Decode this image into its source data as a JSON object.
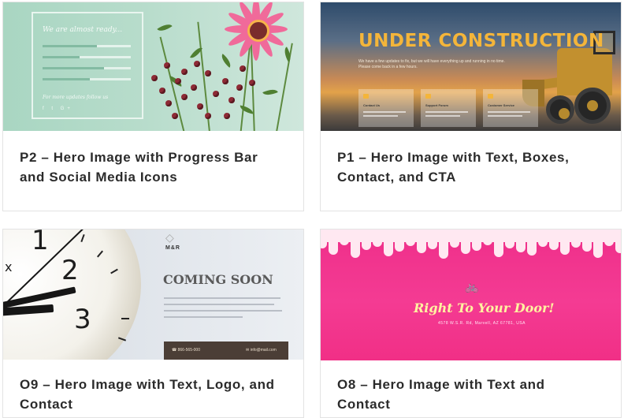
{
  "cards": [
    {
      "title": "P2 – Hero Image with Progress Bar and Social Media Icons",
      "title_line1": "P2 – Hero Image with Progress Bar",
      "title_line2": "and Social Media Icons",
      "preview": {
        "heading": "We are almost ready...",
        "progress": [
          0.62,
          0.42,
          0.7,
          0.54
        ],
        "footer": "For more updates follow us",
        "social_icons": [
          "facebook-icon",
          "twitter-icon",
          "google-plus-icon"
        ],
        "social_glyphs": "f t G+"
      }
    },
    {
      "title": "P1 – Hero Image with Text, Boxes, Contact, and CTA",
      "title_line1": "P1 – Hero Image with Text, Boxes,",
      "title_line2": "Contact, and CTA",
      "preview": {
        "heading": "UNDER CONSTRUCTION",
        "intro": "We have a few updates to fix, but we will have everything up and running in no time. Please come back in a few hours.",
        "boxes": [
          "Contact Us",
          "Support Forum",
          "Customer Service"
        ]
      }
    },
    {
      "title": "O9 – Hero Image with Text, Logo, and Contact",
      "title_line1": "O9 – Hero Image with Text, Logo, and",
      "title_line2": "Contact",
      "preview": {
        "logo": "M&R",
        "heading": "COMING SOON",
        "phone": "866-565-000",
        "email": "info@mail.com"
      }
    },
    {
      "title": "O8 – Hero Image with Text and Contact",
      "title_line1": "O8 – Hero Image with Text and",
      "title_line2": "Contact",
      "preview": {
        "heading": "Right To Your Door!",
        "address": "4578 W.S.R. Rd, Marvell, AZ 67781, USA"
      }
    }
  ],
  "colors": {
    "title_text": "#2b2b2b",
    "card_border": "#e3e3e3",
    "p2_mint": "#a9d6c2",
    "p1_orange": "#f4b53a",
    "o8_pink": "#ef2f8a"
  }
}
